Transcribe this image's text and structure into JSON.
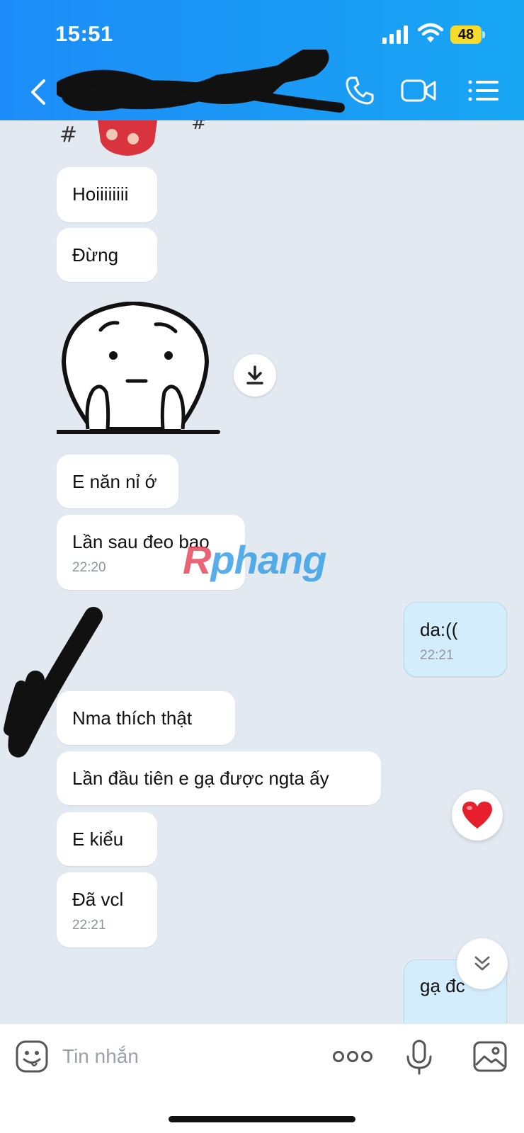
{
  "status_bar": {
    "time": "15:51",
    "battery": "48"
  },
  "header": {
    "contact_name": ""
  },
  "messages": [
    {
      "text": "Hoiiiiiiii"
    },
    {
      "text": "Đừng"
    },
    {
      "text": "E năn nỉ ớ"
    },
    {
      "text": "Lần sau đeo bao",
      "time": "22:20"
    },
    {
      "text": "da:((",
      "time": "22:21"
    },
    {
      "text": "Nma thích thật"
    },
    {
      "text": "Lần đầu tiên e gạ được ngta ấy"
    },
    {
      "text": "E kiểu"
    },
    {
      "text": "Đã vcl",
      "time": "22:21"
    },
    {
      "text": "gạ đc"
    }
  ],
  "watermark": {
    "part1": "R",
    "part2": "phang"
  },
  "composer": {
    "placeholder": "Tin nhắn"
  },
  "colors": {
    "header_blue": "#1d8cf8",
    "chat_bg": "#e2e9f1",
    "my_bubble": "#d4edfc",
    "heart": "#e8202e",
    "battery": "#f6da2c"
  },
  "icons": [
    "back-icon",
    "call-icon",
    "video-call-icon",
    "menu-list-icon",
    "download-icon",
    "heart-icon",
    "chevron-double-down-icon",
    "emoji-icon",
    "more-icon",
    "microphone-icon",
    "gallery-icon"
  ]
}
